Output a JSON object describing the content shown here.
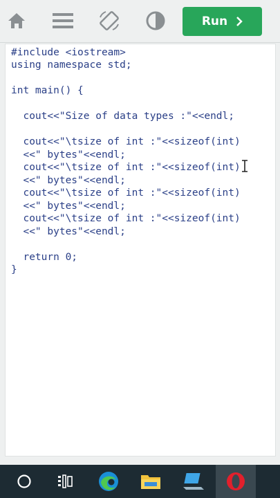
{
  "toolbar": {
    "icons": [
      "home-icon",
      "menu-icon",
      "rotate-icon",
      "contrast-icon"
    ],
    "run_label": "Run"
  },
  "code": {
    "lines": [
      "#include <iostream>",
      "using namespace std;",
      "",
      "int main() {",
      "",
      "  cout<<\"Size of data types :\"<<endl;",
      "",
      "  cout<<\"\\tsize of int :\"<<sizeof(int)",
      "  <<\" bytes\"<<endl;",
      "  cout<<\"\\tsize of int :\"<<sizeof(int)",
      "  <<\" bytes\"<<endl;",
      "  cout<<\"\\tsize of int :\"<<sizeof(int)",
      "  <<\" bytes\"<<endl;",
      "  cout<<\"\\tsize of int :\"<<sizeof(int)",
      "  <<\" bytes\"<<endl;",
      "",
      "  return 0;",
      "}"
    ]
  },
  "taskbar": {
    "items": [
      "start-icon",
      "task-view-icon",
      "edge-browser-icon",
      "file-explorer-icon",
      "laptop-app-icon",
      "opera-browser-icon"
    ]
  },
  "colors": {
    "accent": "#28a65a",
    "code_text": "#2a3f87",
    "taskbar": "#1d2b33"
  }
}
